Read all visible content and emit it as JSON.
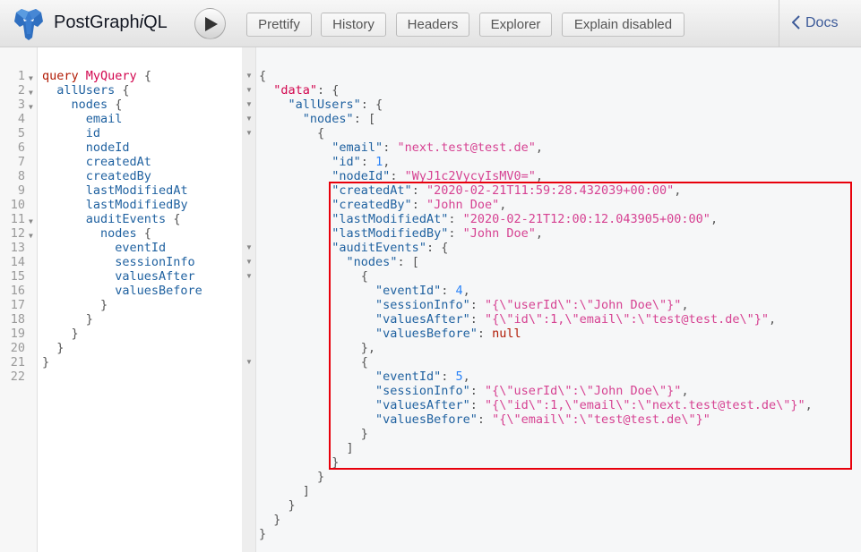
{
  "app": {
    "title_prefix": "PostGraph",
    "title_italic": "i",
    "title_suffix": "QL",
    "logo_icon": "postgres-elephant-icon"
  },
  "toolbar": {
    "run_icon": "play-icon",
    "buttons": [
      {
        "label": "Prettify"
      },
      {
        "label": "History"
      },
      {
        "label": "Headers"
      },
      {
        "label": "Explorer"
      },
      {
        "label": "Explain disabled"
      }
    ],
    "docs_label": "Docs",
    "docs_icon": "chevron-left-icon"
  },
  "query_editor": {
    "lines": [
      {
        "n": "1",
        "fold": true,
        "indent": 0,
        "tokens": [
          {
            "t": "query",
            "c": "kw"
          },
          {
            "t": " "
          },
          {
            "t": "MyQuery",
            "c": "def"
          },
          {
            "t": " {",
            "c": "punc"
          }
        ]
      },
      {
        "n": "2",
        "fold": true,
        "indent": 1,
        "tokens": [
          {
            "t": "allUsers",
            "c": "fld"
          },
          {
            "t": " {",
            "c": "punc"
          }
        ]
      },
      {
        "n": "3",
        "fold": true,
        "indent": 2,
        "tokens": [
          {
            "t": "nodes",
            "c": "fld"
          },
          {
            "t": " {",
            "c": "punc"
          }
        ]
      },
      {
        "n": "4",
        "fold": false,
        "indent": 3,
        "tokens": [
          {
            "t": "email",
            "c": "fld"
          }
        ]
      },
      {
        "n": "5",
        "fold": false,
        "indent": 3,
        "tokens": [
          {
            "t": "id",
            "c": "fld"
          }
        ]
      },
      {
        "n": "6",
        "fold": false,
        "indent": 3,
        "tokens": [
          {
            "t": "nodeId",
            "c": "fld"
          }
        ]
      },
      {
        "n": "7",
        "fold": false,
        "indent": 3,
        "tokens": [
          {
            "t": "createdAt",
            "c": "fld"
          }
        ]
      },
      {
        "n": "8",
        "fold": false,
        "indent": 3,
        "tokens": [
          {
            "t": "createdBy",
            "c": "fld"
          }
        ]
      },
      {
        "n": "9",
        "fold": false,
        "indent": 3,
        "tokens": [
          {
            "t": "lastModifiedAt",
            "c": "fld"
          }
        ]
      },
      {
        "n": "10",
        "fold": false,
        "indent": 3,
        "tokens": [
          {
            "t": "lastModifiedBy",
            "c": "fld"
          }
        ]
      },
      {
        "n": "11",
        "fold": true,
        "indent": 3,
        "tokens": [
          {
            "t": "auditEvents",
            "c": "fld"
          },
          {
            "t": " {",
            "c": "punc"
          }
        ]
      },
      {
        "n": "12",
        "fold": true,
        "indent": 4,
        "tokens": [
          {
            "t": "nodes",
            "c": "fld"
          },
          {
            "t": " {",
            "c": "punc"
          }
        ]
      },
      {
        "n": "13",
        "fold": false,
        "indent": 5,
        "tokens": [
          {
            "t": "eventId",
            "c": "fld"
          }
        ]
      },
      {
        "n": "14",
        "fold": false,
        "indent": 5,
        "tokens": [
          {
            "t": "sessionInfo",
            "c": "fld"
          }
        ]
      },
      {
        "n": "15",
        "fold": false,
        "indent": 5,
        "tokens": [
          {
            "t": "valuesAfter",
            "c": "fld"
          }
        ]
      },
      {
        "n": "16",
        "fold": false,
        "indent": 5,
        "tokens": [
          {
            "t": "valuesBefore",
            "c": "fld"
          }
        ]
      },
      {
        "n": "17",
        "fold": false,
        "indent": 4,
        "tokens": [
          {
            "t": "}",
            "c": "punc"
          }
        ]
      },
      {
        "n": "18",
        "fold": false,
        "indent": 3,
        "tokens": [
          {
            "t": "}",
            "c": "punc"
          }
        ]
      },
      {
        "n": "19",
        "fold": false,
        "indent": 2,
        "tokens": [
          {
            "t": "}",
            "c": "punc"
          }
        ]
      },
      {
        "n": "20",
        "fold": false,
        "indent": 1,
        "tokens": [
          {
            "t": "}",
            "c": "punc"
          }
        ]
      },
      {
        "n": "21",
        "fold": false,
        "indent": 0,
        "tokens": [
          {
            "t": "}",
            "c": "punc"
          }
        ]
      },
      {
        "n": "22",
        "fold": false,
        "indent": 0,
        "tokens": []
      }
    ]
  },
  "result_viewer": {
    "lines": [
      {
        "fold": true,
        "indent": 0,
        "tokens": [
          {
            "t": "{",
            "c": "brace"
          }
        ]
      },
      {
        "fold": true,
        "indent": 1,
        "tokens": [
          {
            "t": "\"data\"",
            "c": "datakey"
          },
          {
            "t": ": {",
            "c": "punc"
          }
        ]
      },
      {
        "fold": true,
        "indent": 2,
        "tokens": [
          {
            "t": "\"allUsers\"",
            "c": "key"
          },
          {
            "t": ": {",
            "c": "punc"
          }
        ]
      },
      {
        "fold": true,
        "indent": 3,
        "tokens": [
          {
            "t": "\"nodes\"",
            "c": "key"
          },
          {
            "t": ": [",
            "c": "punc"
          }
        ]
      },
      {
        "fold": true,
        "indent": 4,
        "tokens": [
          {
            "t": "{",
            "c": "brace"
          }
        ]
      },
      {
        "fold": false,
        "indent": 5,
        "tokens": [
          {
            "t": "\"email\"",
            "c": "key"
          },
          {
            "t": ": ",
            "c": "punc"
          },
          {
            "t": "\"next.test@test.de\"",
            "c": "str"
          },
          {
            "t": ",",
            "c": "punc"
          }
        ]
      },
      {
        "fold": false,
        "indent": 5,
        "tokens": [
          {
            "t": "\"id\"",
            "c": "key"
          },
          {
            "t": ": ",
            "c": "punc"
          },
          {
            "t": "1",
            "c": "num"
          },
          {
            "t": ",",
            "c": "punc"
          }
        ]
      },
      {
        "fold": false,
        "indent": 5,
        "tokens": [
          {
            "t": "\"nodeId\"",
            "c": "key"
          },
          {
            "t": ": ",
            "c": "punc"
          },
          {
            "t": "\"WyJ1c2VycyIsMV0=\"",
            "c": "str"
          },
          {
            "t": ",",
            "c": "punc"
          }
        ]
      },
      {
        "fold": false,
        "indent": 5,
        "tokens": [
          {
            "t": "\"createdAt\"",
            "c": "key"
          },
          {
            "t": ": ",
            "c": "punc"
          },
          {
            "t": "\"2020-02-21T11:59:28.432039+00:00\"",
            "c": "str"
          },
          {
            "t": ",",
            "c": "punc"
          }
        ]
      },
      {
        "fold": false,
        "indent": 5,
        "tokens": [
          {
            "t": "\"createdBy\"",
            "c": "key"
          },
          {
            "t": ": ",
            "c": "punc"
          },
          {
            "t": "\"John Doe\"",
            "c": "str"
          },
          {
            "t": ",",
            "c": "punc"
          }
        ]
      },
      {
        "fold": false,
        "indent": 5,
        "tokens": [
          {
            "t": "\"lastModifiedAt\"",
            "c": "key"
          },
          {
            "t": ": ",
            "c": "punc"
          },
          {
            "t": "\"2020-02-21T12:00:12.043905+00:00\"",
            "c": "str"
          },
          {
            "t": ",",
            "c": "punc"
          }
        ]
      },
      {
        "fold": false,
        "indent": 5,
        "tokens": [
          {
            "t": "\"lastModifiedBy\"",
            "c": "key"
          },
          {
            "t": ": ",
            "c": "punc"
          },
          {
            "t": "\"John Doe\"",
            "c": "str"
          },
          {
            "t": ",",
            "c": "punc"
          }
        ]
      },
      {
        "fold": true,
        "indent": 5,
        "tokens": [
          {
            "t": "\"auditEvents\"",
            "c": "key"
          },
          {
            "t": ": {",
            "c": "punc"
          }
        ]
      },
      {
        "fold": true,
        "indent": 6,
        "tokens": [
          {
            "t": "\"nodes\"",
            "c": "key"
          },
          {
            "t": ": [",
            "c": "punc"
          }
        ]
      },
      {
        "fold": true,
        "indent": 7,
        "tokens": [
          {
            "t": "{",
            "c": "brace"
          }
        ]
      },
      {
        "fold": false,
        "indent": 8,
        "tokens": [
          {
            "t": "\"eventId\"",
            "c": "key"
          },
          {
            "t": ": ",
            "c": "punc"
          },
          {
            "t": "4",
            "c": "num"
          },
          {
            "t": ",",
            "c": "punc"
          }
        ]
      },
      {
        "fold": false,
        "indent": 8,
        "tokens": [
          {
            "t": "\"sessionInfo\"",
            "c": "key"
          },
          {
            "t": ": ",
            "c": "punc"
          },
          {
            "t": "\"{\\\"userId\\\":\\\"John Doe\\\"}\"",
            "c": "str"
          },
          {
            "t": ",",
            "c": "punc"
          }
        ]
      },
      {
        "fold": false,
        "indent": 8,
        "tokens": [
          {
            "t": "\"valuesAfter\"",
            "c": "key"
          },
          {
            "t": ": ",
            "c": "punc"
          },
          {
            "t": "\"{\\\"id\\\":1,\\\"email\\\":\\\"test@test.de\\\"}\"",
            "c": "str"
          },
          {
            "t": ",",
            "c": "punc"
          }
        ]
      },
      {
        "fold": false,
        "indent": 8,
        "tokens": [
          {
            "t": "\"valuesBefore\"",
            "c": "key"
          },
          {
            "t": ": ",
            "c": "punc"
          },
          {
            "t": "null",
            "c": "nul"
          }
        ]
      },
      {
        "fold": false,
        "indent": 7,
        "tokens": [
          {
            "t": "},",
            "c": "brace"
          }
        ]
      },
      {
        "fold": true,
        "indent": 7,
        "tokens": [
          {
            "t": "{",
            "c": "brace"
          }
        ]
      },
      {
        "fold": false,
        "indent": 8,
        "tokens": [
          {
            "t": "\"eventId\"",
            "c": "key"
          },
          {
            "t": ": ",
            "c": "punc"
          },
          {
            "t": "5",
            "c": "num"
          },
          {
            "t": ",",
            "c": "punc"
          }
        ]
      },
      {
        "fold": false,
        "indent": 8,
        "tokens": [
          {
            "t": "\"sessionInfo\"",
            "c": "key"
          },
          {
            "t": ": ",
            "c": "punc"
          },
          {
            "t": "\"{\\\"userId\\\":\\\"John Doe\\\"}\"",
            "c": "str"
          },
          {
            "t": ",",
            "c": "punc"
          }
        ]
      },
      {
        "fold": false,
        "indent": 8,
        "tokens": [
          {
            "t": "\"valuesAfter\"",
            "c": "key"
          },
          {
            "t": ": ",
            "c": "punc"
          },
          {
            "t": "\"{\\\"id\\\":1,\\\"email\\\":\\\"next.test@test.de\\\"}\"",
            "c": "str"
          },
          {
            "t": ",",
            "c": "punc"
          }
        ]
      },
      {
        "fold": false,
        "indent": 8,
        "tokens": [
          {
            "t": "\"valuesBefore\"",
            "c": "key"
          },
          {
            "t": ": ",
            "c": "punc"
          },
          {
            "t": "\"{\\\"email\\\":\\\"test@test.de\\\"}\"",
            "c": "str"
          }
        ]
      },
      {
        "fold": false,
        "indent": 7,
        "tokens": [
          {
            "t": "}",
            "c": "brace"
          }
        ]
      },
      {
        "fold": false,
        "indent": 6,
        "tokens": [
          {
            "t": "]",
            "c": "brace"
          }
        ]
      },
      {
        "fold": false,
        "indent": 5,
        "tokens": [
          {
            "t": "}",
            "c": "brace"
          }
        ]
      },
      {
        "fold": false,
        "indent": 4,
        "tokens": [
          {
            "t": "}",
            "c": "brace"
          }
        ]
      },
      {
        "fold": false,
        "indent": 3,
        "tokens": [
          {
            "t": "]",
            "c": "brace"
          }
        ]
      },
      {
        "fold": false,
        "indent": 2,
        "tokens": [
          {
            "t": "}",
            "c": "brace"
          }
        ]
      },
      {
        "fold": false,
        "indent": 1,
        "tokens": [
          {
            "t": "}",
            "c": "brace"
          }
        ]
      },
      {
        "fold": false,
        "indent": 0,
        "tokens": [
          {
            "t": "}",
            "c": "brace"
          }
        ]
      }
    ]
  },
  "annotation": {
    "highlight_color": "#e8000b"
  }
}
